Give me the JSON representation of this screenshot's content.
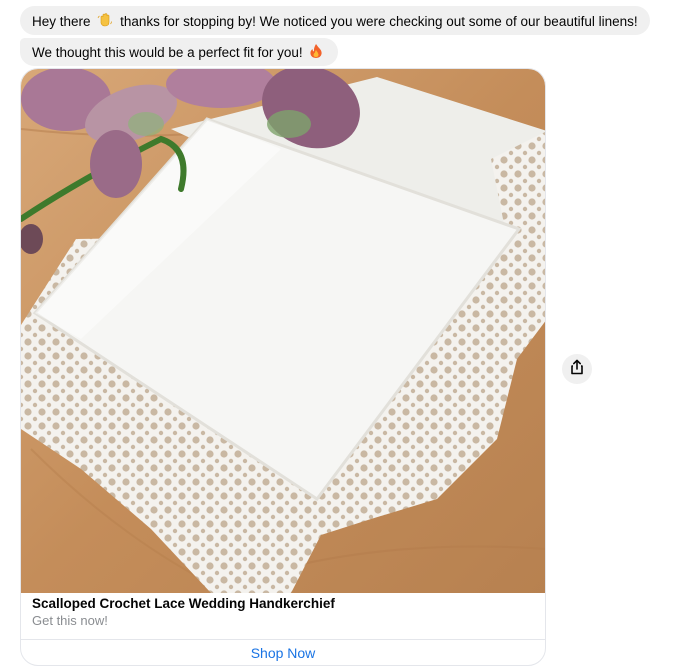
{
  "messages": [
    {
      "before": "Hey there",
      "emoji": "waving-hand-icon",
      "after": "thanks for stopping by! We noticed you were checking out some of our beautiful linens!"
    },
    {
      "text": "We thought this would be a perfect fit for you!",
      "emoji": "fire-icon"
    }
  ],
  "card": {
    "image_alt": "White handkerchief with crochet lace border and purple orchid flowers on a wooden surface",
    "title": "Scalloped Crochet Lace Wedding Handkerchief",
    "subtitle": "Get this now!",
    "button_label": "Shop Now"
  },
  "share": {
    "icon": "share-icon"
  },
  "colors": {
    "bubble_bg": "#f0f0f0",
    "button_text": "#1a74e4",
    "subtitle_text": "#8a8d91",
    "wood": "#c9935f",
    "cloth": "#f3f3f1",
    "orchid": "#9a6b88"
  }
}
